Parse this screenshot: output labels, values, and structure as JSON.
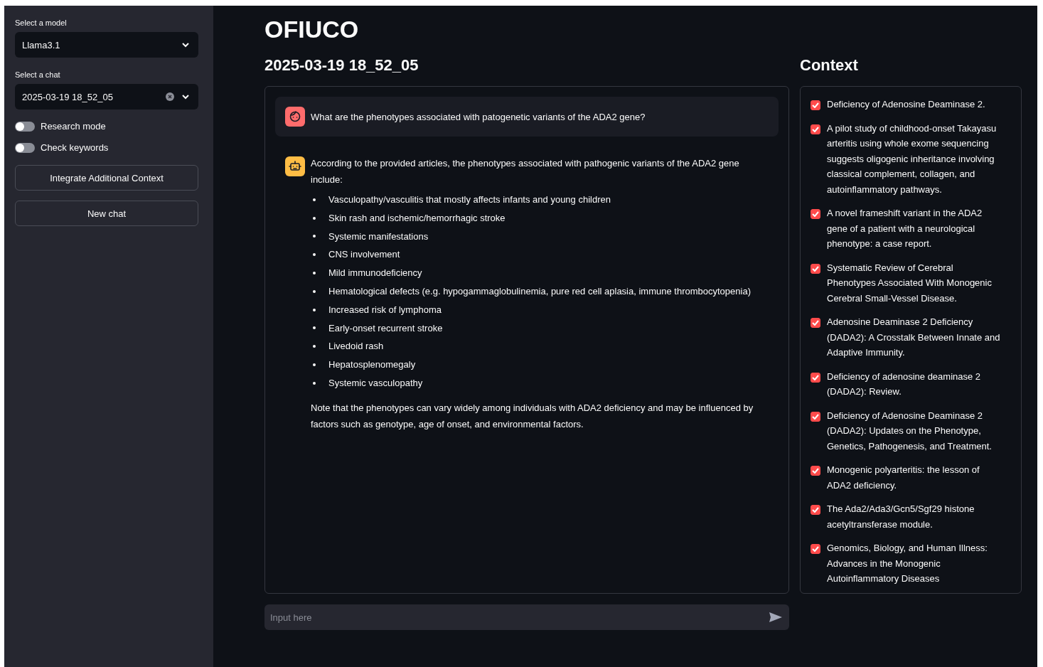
{
  "sidebar": {
    "model_select": {
      "label": "Select a model",
      "value": "Llama3.1"
    },
    "chat_select": {
      "label": "Select a chat",
      "value": "2025-03-19 18_52_05"
    },
    "toggles": [
      {
        "label": "Research mode",
        "on": false
      },
      {
        "label": "Check keywords",
        "on": false
      }
    ],
    "buttons": [
      "Integrate Additional Context",
      "New chat"
    ]
  },
  "title": "OFIUCO",
  "chat": {
    "title": "2025-03-19 18_52_05",
    "messages": [
      {
        "kind": "user",
        "text": "What are the phenotypes associated with patogenetic variants of the ADA2 gene?"
      },
      {
        "kind": "assistant",
        "intro": "According to the provided articles, the phenotypes associated with pathogenic variants of the ADA2 gene include:",
        "bullets": [
          "Vasculopathy/vasculitis that mostly affects infants and young children",
          "Skin rash and ischemic/hemorrhagic stroke",
          "Systemic manifestations",
          "CNS involvement",
          "Mild immunodeficiency",
          "Hematological defects (e.g. hypogammaglobulinemia, pure red cell aplasia, immune thrombocytopenia)",
          "Increased risk of lymphoma",
          "Early-onset recurrent stroke",
          "Livedoid rash",
          "Hepatosplenomegaly",
          "Systemic vasculopathy"
        ],
        "note": "Note that the phenotypes can vary widely among individuals with ADA2 deficiency and may be influenced by factors such as genotype, age of onset, and environmental factors."
      }
    ],
    "input": {
      "placeholder": "Input here"
    }
  },
  "context": {
    "title": "Context",
    "items": [
      {
        "label": "Deficiency of Adenosine Deaminase 2.",
        "checked": true
      },
      {
        "label": "A pilot study of childhood-onset Takayasu arteritis using whole exome sequencing suggests oligogenic inheritance involving classical complement, collagen, and autoinflammatory pathways.",
        "checked": true
      },
      {
        "label": "A novel frameshift variant in the ADA2 gene of a patient with a neurological phenotype: a case report.",
        "checked": true
      },
      {
        "label": "Systematic Review of Cerebral Phenotypes Associated With Monogenic Cerebral Small-Vessel Disease.",
        "checked": true
      },
      {
        "label": "Adenosine Deaminase 2 Deficiency (DADA2): A Crosstalk Between Innate and Adaptive Immunity.",
        "checked": true
      },
      {
        "label": "Deficiency of adenosine deaminase 2 (DADA2): Review.",
        "checked": true
      },
      {
        "label": "Deficiency of Adenosine Deaminase 2 (DADA2): Updates on the Phenotype, Genetics, Pathogenesis, and Treatment.",
        "checked": true
      },
      {
        "label": "Monogenic polyarteritis: the lesson of ADA2 deficiency.",
        "checked": true
      },
      {
        "label": "The Ada2/Ada3/Gcn5/Sgf29 histone acetyltransferase module.",
        "checked": true
      },
      {
        "label": "Genomics, Biology, and Human Illness: Advances in the Monogenic Autoinflammatory Diseases",
        "checked": true
      }
    ]
  }
}
